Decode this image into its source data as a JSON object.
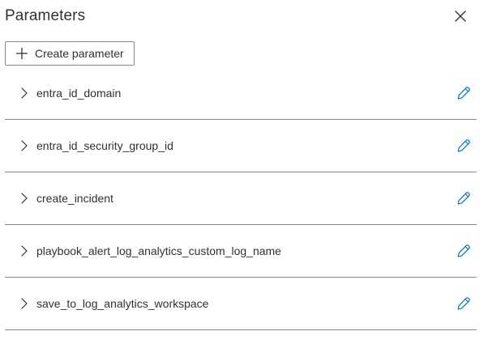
{
  "panel": {
    "title": "Parameters",
    "close_icon": "close-icon"
  },
  "toolbar": {
    "create_label": "Create parameter",
    "create_icon": "plus-icon"
  },
  "parameters": [
    {
      "name": "entra_id_domain"
    },
    {
      "name": "entra_id_security_group_id"
    },
    {
      "name": "create_incident"
    },
    {
      "name": "playbook_alert_log_analytics_custom_log_name"
    },
    {
      "name": "save_to_log_analytics_workspace"
    }
  ],
  "colors": {
    "accent": "#0078d4",
    "text": "#323130",
    "divider": "#8a8886"
  }
}
